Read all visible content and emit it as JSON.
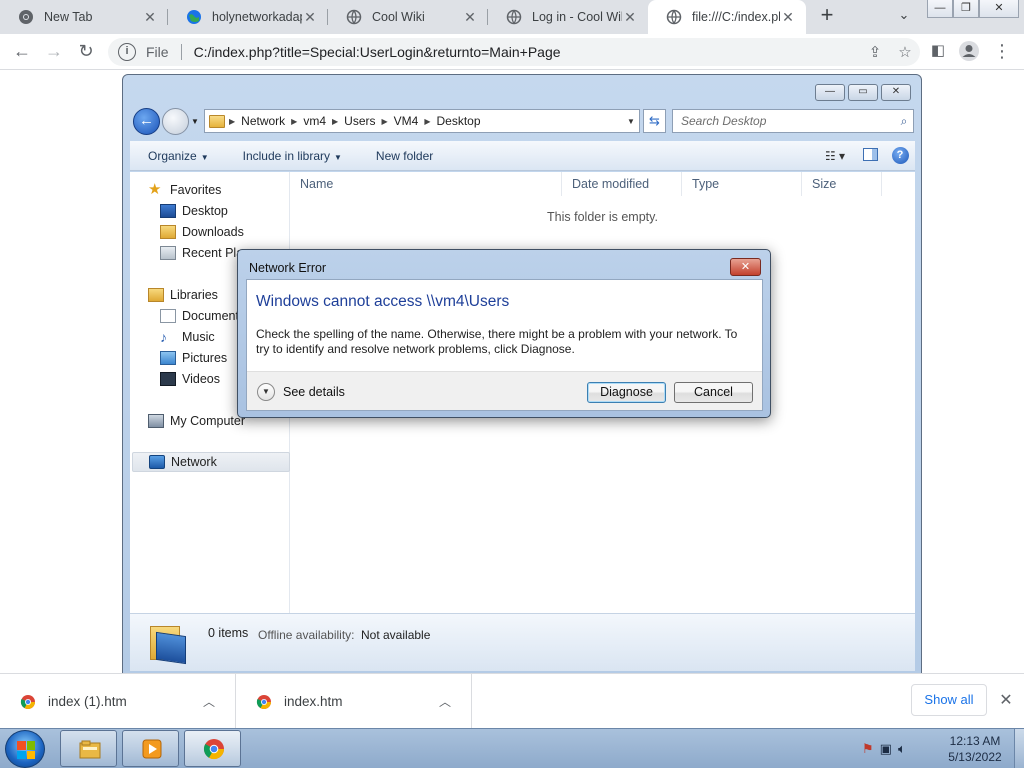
{
  "browser": {
    "tabs": [
      {
        "title": "New Tab",
        "icon": "chrome-icon"
      },
      {
        "title": "holynetworkadap",
        "icon": "globe-icon"
      },
      {
        "title": "Cool Wiki",
        "icon": "globe-icon"
      },
      {
        "title": "Log in - Cool Wiki",
        "icon": "globe-icon"
      },
      {
        "title": "file:///C:/index.php",
        "icon": "globe-icon",
        "active": true
      }
    ],
    "new_tab": "+",
    "address": {
      "scheme_label": "File",
      "url": "C:/index.php?title=Special:UserLogin&returnto=Main+Page"
    }
  },
  "explorer": {
    "breadcrumb": [
      "Network",
      "vm4",
      "Users",
      "VM4",
      "Desktop"
    ],
    "search_placeholder": "Search Desktop",
    "commands": {
      "organize": "Organize",
      "include_in_library": "Include in library",
      "new_folder": "New folder"
    },
    "nav": {
      "favorites": "Favorites",
      "desktop": "Desktop",
      "downloads": "Downloads",
      "recent_places": "Recent Places",
      "libraries": "Libraries",
      "documents": "Documents",
      "music": "Music",
      "pictures": "Pictures",
      "videos": "Videos",
      "my_computer": "My Computer",
      "network": "Network"
    },
    "columns": [
      "Name",
      "Date modified",
      "Type",
      "Size"
    ],
    "empty_message": "This folder is empty.",
    "details": {
      "count": "0 items",
      "offline_label": "Offline availability:",
      "offline_value": "Not available"
    }
  },
  "dialog": {
    "title": "Network Error",
    "heading": "Windows cannot access \\\\vm4\\Users",
    "message": "Check the spelling of the name. Otherwise, there might be a problem with your network. To try to identify and resolve network problems, click Diagnose.",
    "see_details": "See details",
    "diagnose": "Diagnose",
    "cancel": "Cancel"
  },
  "downloads": {
    "items": [
      {
        "name": "index (1).htm"
      },
      {
        "name": "index.htm"
      }
    ],
    "show_all": "Show all"
  },
  "taskbar": {
    "time": "12:13 AM",
    "date": "5/13/2022"
  },
  "colors": {
    "chrome_tabstrip": "#dee1e6",
    "dialog_heading": "#1e3f99",
    "link_blue": "#1a73e8"
  }
}
